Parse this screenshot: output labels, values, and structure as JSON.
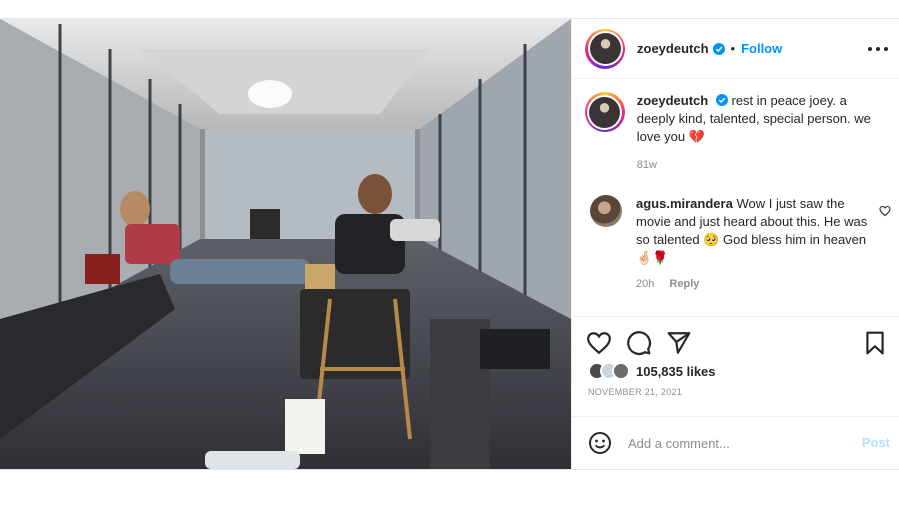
{
  "post": {
    "username": "zoeydeutch",
    "dot": "•",
    "follow_label": "Follow",
    "more_icon": "more-horizontal-icon",
    "caption_text": "rest in peace joey. a deeply kind, talented, special person. we love you",
    "caption_emoji": "💔",
    "caption_age": "81w",
    "verified_color": "#0095f6",
    "follow_color": "#0095f6"
  },
  "comment": {
    "username": "agus.mirandera",
    "text": "Wow I just saw the movie and just heard about this. He was so talented",
    "emoji_1": "🥺",
    "text_2": "God bless him in heaven",
    "emoji_2": "🤞🏻🌹",
    "age": "20h",
    "reply_label": "Reply"
  },
  "actions": {
    "like_icon": "heart-icon",
    "comment_icon": "comment-icon",
    "share_icon": "send-icon",
    "save_icon": "bookmark-icon"
  },
  "likes": {
    "count_label": "105,835 likes"
  },
  "date": "NOVEMBER 21, 2021",
  "add_comment": {
    "placeholder": "Add a comment...",
    "post_label": "Post",
    "emoji_icon": "smiley-icon"
  }
}
